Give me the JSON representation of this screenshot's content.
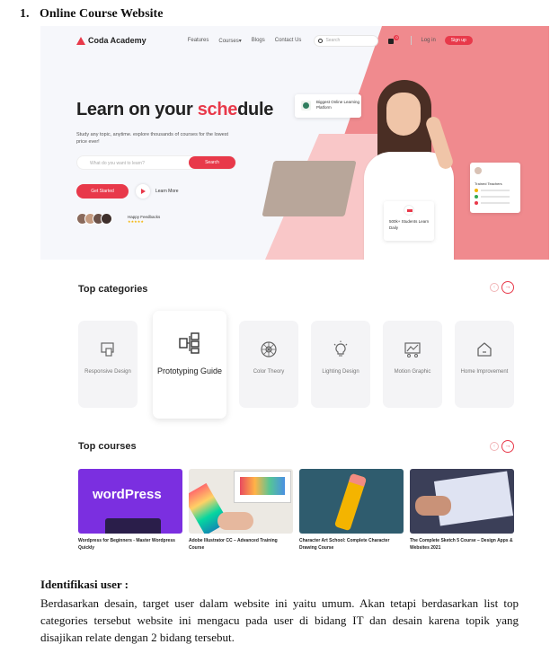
{
  "heading": {
    "number": "1.",
    "title": "Online Course Website"
  },
  "site": {
    "brand": "Coda Academy",
    "nav": [
      "Features",
      "Courses",
      "Blogs",
      "Contact Us"
    ],
    "search_placeholder": "Search",
    "cart_count": "0",
    "login": "Log in",
    "signup": "Sign up",
    "hero": {
      "title_prefix": "Learn on your ",
      "title_accent": "sche",
      "title_suffix": "dule",
      "subtitle": "Study any topic, anytime. explore thousands of courses for the lowest price ever!",
      "search_placeholder": "What do you want to learn?",
      "search_button": "Search",
      "get_started": "Get Started",
      "learn_more": "Learn More",
      "feedback": "Happy Feedbacks",
      "online_card": "Biggest Online Learning Platform",
      "teachers_card": "Trained Teachers",
      "students_card": "500k+ Students Learn Daily",
      "accent_color": "#e8394a"
    },
    "top_categories": {
      "title": "Top categories",
      "items": [
        {
          "label": "Responsive Design",
          "icon": "responsive-icon"
        },
        {
          "label": "Prototyping Guide",
          "icon": "prototype-icon"
        },
        {
          "label": "Color Theory",
          "icon": "color-wheel-icon"
        },
        {
          "label": "Lighting Design",
          "icon": "lightbulb-icon"
        },
        {
          "label": "Motion Graphic",
          "icon": "motion-icon"
        },
        {
          "label": "Home Improvement",
          "icon": "home-icon"
        }
      ]
    },
    "top_courses": {
      "title": "Top courses",
      "items": [
        {
          "title": "Wordpress for Beginners - Master Wordpress Quickly",
          "thumb_text": "wordPress"
        },
        {
          "title": "Adobe Illustrator CC – Advanced Training Course"
        },
        {
          "title": "Character Art School: Complete Character Drawing Course"
        },
        {
          "title": "The Complete Sketch 5 Course – Design Apps & Websites 2021"
        }
      ]
    }
  },
  "identification": {
    "title": "Identifikasi user :",
    "body": "Berdasarkan desain, target user dalam website ini yaitu umum. Akan tetapi berdasarkan list top categories tersebut website ini mengacu pada user di bidang IT dan desain karena topik yang disajikan relate dengan 2 bidang tersebut."
  }
}
